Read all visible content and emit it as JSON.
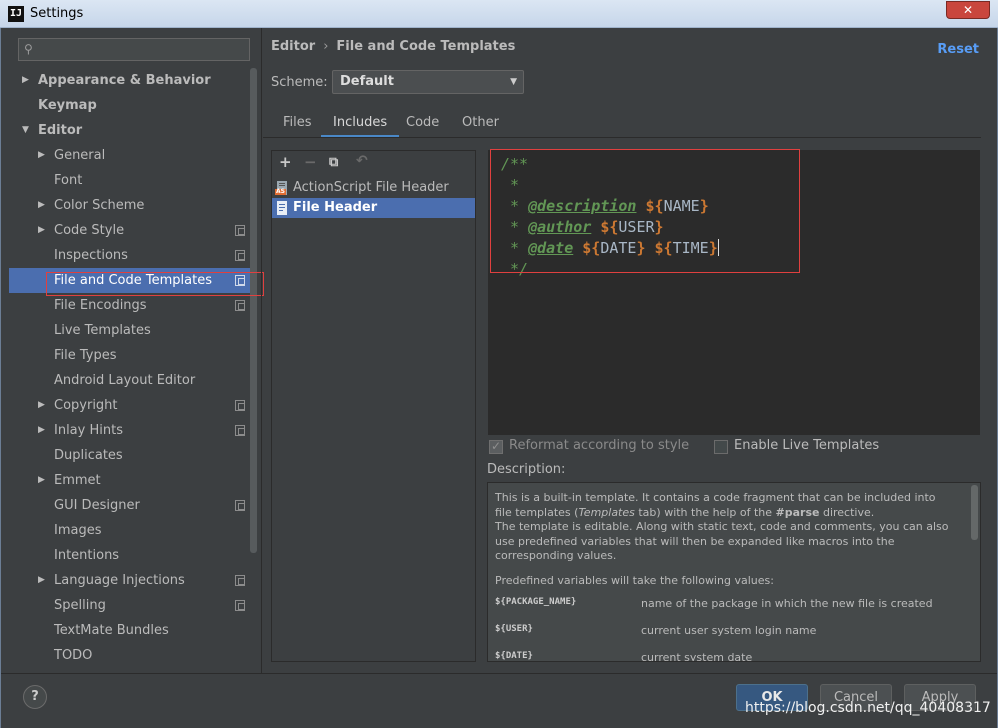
{
  "window": {
    "title": "Settings",
    "app_badge": "IJ",
    "close_glyph": "✕"
  },
  "search": {
    "value": "",
    "icon": "search-icon"
  },
  "sidebar": {
    "items": [
      {
        "label": "Appearance & Behavior",
        "level": 0,
        "arrow": "▶",
        "bold": true
      },
      {
        "label": "Keymap",
        "level": 0,
        "bold": true
      },
      {
        "label": "Editor",
        "level": 0,
        "arrow": "▼",
        "bold": true
      },
      {
        "label": "General",
        "level": 1,
        "arrow": "▶"
      },
      {
        "label": "Font",
        "level": 1
      },
      {
        "label": "Color Scheme",
        "level": 1,
        "arrow": "▶"
      },
      {
        "label": "Code Style",
        "level": 1,
        "arrow": "▶",
        "copy": true
      },
      {
        "label": "Inspections",
        "level": 1,
        "copy": true
      },
      {
        "label": "File and Code Templates",
        "level": 1,
        "copy": true,
        "selected": true
      },
      {
        "label": "File Encodings",
        "level": 1,
        "copy": true
      },
      {
        "label": "Live Templates",
        "level": 1
      },
      {
        "label": "File Types",
        "level": 1
      },
      {
        "label": "Android Layout Editor",
        "level": 1
      },
      {
        "label": "Copyright",
        "level": 1,
        "arrow": "▶",
        "copy": true
      },
      {
        "label": "Inlay Hints",
        "level": 1,
        "arrow": "▶",
        "copy": true
      },
      {
        "label": "Duplicates",
        "level": 1
      },
      {
        "label": "Emmet",
        "level": 1,
        "arrow": "▶"
      },
      {
        "label": "GUI Designer",
        "level": 1,
        "copy": true
      },
      {
        "label": "Images",
        "level": 1
      },
      {
        "label": "Intentions",
        "level": 1
      },
      {
        "label": "Language Injections",
        "level": 1,
        "arrow": "▶",
        "copy": true
      },
      {
        "label": "Spelling",
        "level": 1,
        "copy": true
      },
      {
        "label": "TextMate Bundles",
        "level": 1
      },
      {
        "label": "TODO",
        "level": 1
      }
    ]
  },
  "header": {
    "breadcrumb_parent": "Editor",
    "breadcrumb_sep": "›",
    "breadcrumb_current": "File and Code Templates",
    "reset_label": "Reset"
  },
  "scheme": {
    "label": "Scheme:",
    "value": "Default",
    "caret": "▼"
  },
  "tabs": [
    {
      "label": "Files",
      "active": false
    },
    {
      "label": "Includes",
      "active": true
    },
    {
      "label": "Code",
      "active": false
    },
    {
      "label": "Other",
      "active": false
    }
  ],
  "toolbar": {
    "add": "+",
    "remove": "−",
    "copy": "⧉",
    "reset": "↶"
  },
  "templates": [
    {
      "label": "ActionScript File Header",
      "badge": "AS",
      "selected": false
    },
    {
      "label": "File Header",
      "selected": true
    }
  ],
  "editor": {
    "lines": [
      {
        "prefix": "/**"
      },
      {
        "prefix": " *"
      },
      {
        "prefix": " * ",
        "tag": "@description",
        "vars": [
          "NAME"
        ]
      },
      {
        "prefix": " * ",
        "tag": "@author",
        "vars": [
          "USER"
        ]
      },
      {
        "prefix": " * ",
        "tag": "@date",
        "vars": [
          "DATE",
          "TIME"
        ],
        "caret": true
      },
      {
        "prefix": " */"
      }
    ]
  },
  "options": {
    "reformat_label": "Reformat according to style",
    "reformat_checked": true,
    "live_templates_label": "Enable Live Templates",
    "live_templates_checked": false
  },
  "description": {
    "label": "Description:",
    "para1_a": "This is a built-in template. It contains a code fragment that can be included into file templates (",
    "para1_em": "Templates",
    "para1_b": " tab) with the help of the ",
    "para1_strong": "#parse",
    "para1_c": " directive.",
    "para2": "The template is editable. Along with static text, code and comments, you can also use predefined variables that will then be expanded like macros into the corresponding values.",
    "para3": "Predefined variables will take the following values:",
    "variables": [
      {
        "name": "${PACKAGE_NAME}",
        "desc": "name of the package in which the new file is created"
      },
      {
        "name": "${USER}",
        "desc": "current user system login name"
      },
      {
        "name": "${DATE}",
        "desc": "current system date"
      }
    ]
  },
  "buttons": {
    "help": "?",
    "ok": "OK",
    "cancel": "Cancel",
    "apply": "Apply"
  },
  "watermark": "https://blog.csdn.net/qq_40408317",
  "colors": {
    "accent": "#4b6eaf",
    "link": "#589df6",
    "highlight": "#e0403f",
    "comment": "#629755",
    "dollar": "#cc7832"
  }
}
